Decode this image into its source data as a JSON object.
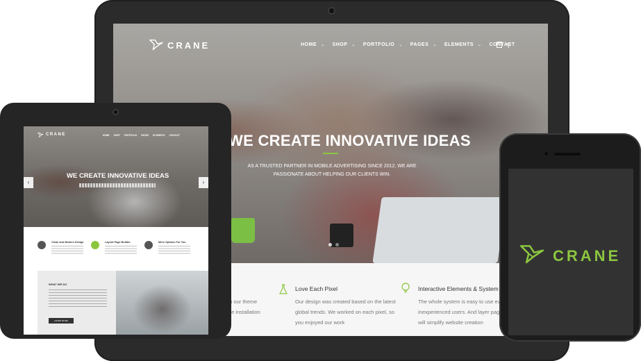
{
  "brand": {
    "name": "CRANE",
    "accent": "#8cc63f"
  },
  "laptop": {
    "nav": {
      "items": [
        {
          "label": "HOME",
          "has_dropdown": true
        },
        {
          "label": "SHOP",
          "has_dropdown": true
        },
        {
          "label": "PORTFOLIO",
          "has_dropdown": true
        },
        {
          "label": "PAGES",
          "has_dropdown": true
        },
        {
          "label": "ELEMENTS",
          "has_dropdown": true
        },
        {
          "label": "CONTACT",
          "has_dropdown": false
        }
      ],
      "cart_icon": "shopping-bag-icon",
      "search_icon": "search-icon"
    },
    "hero": {
      "title": "WE CREATE INNOVATIVE IDEAS",
      "subtitle": "AS A TRUSTED PARTNER IN MOBILE ADVERTISING SINCE 2012, WE ARE PASSIONATE ABOUT HELPING OUR CLIENTS WIN."
    },
    "features": [
      {
        "partial_lines": [
          "with our theme",
          "mple installation"
        ]
      },
      {
        "icon": "flask-icon",
        "title": "Love Each Pixel",
        "lines": [
          "Our design was created based on the latest",
          "global trends. We worked on each pixel, so",
          "you enjoyed our work"
        ]
      },
      {
        "icon": "lightbulb-icon",
        "title": "Interactive Elements & System",
        "lines": [
          "The whole system is easy to use even fo",
          "inexperienced users. And layer page bu",
          "will simplify website creation"
        ]
      }
    ]
  },
  "tablet": {
    "nav": {
      "items": [
        "HOME",
        "SHOP",
        "PORTFOLIO",
        "PAGES",
        "ELEMENTS",
        "CONTACT"
      ]
    },
    "hero": {
      "title": "WE CREATE INNOVATIVE IDEAS"
    },
    "features": [
      {
        "title": "Clean and Modern Design"
      },
      {
        "title": "Layout Page Builder"
      },
      {
        "title": "More Options For You"
      }
    ],
    "what_we_do": {
      "title": "WHAT WE DO",
      "button": "LEARN MORE"
    }
  },
  "phone": {
    "logo_text": "CRANE"
  }
}
